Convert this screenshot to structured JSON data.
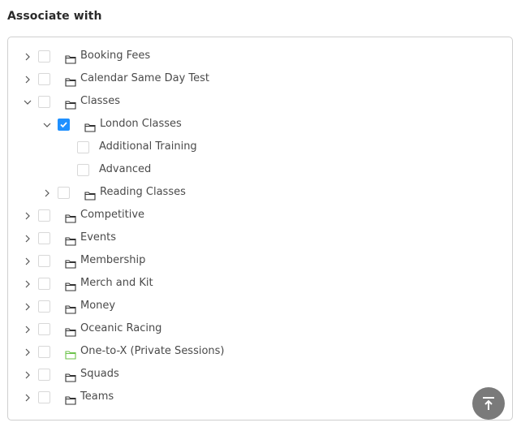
{
  "header": {
    "title": "Associate with"
  },
  "colors": {
    "checked": "#1e90ff",
    "highlight_folder": "#6cc24a",
    "folder": "#333333"
  },
  "tree": [
    {
      "label": "Booking Fees",
      "depth": 0,
      "expander": "collapsed",
      "folder": true,
      "checked": false
    },
    {
      "label": "Calendar Same Day Test",
      "depth": 0,
      "expander": "collapsed",
      "folder": true,
      "checked": false
    },
    {
      "label": "Classes",
      "depth": 0,
      "expander": "expanded",
      "folder": true,
      "checked": false
    },
    {
      "label": "London Classes",
      "depth": 1,
      "expander": "expanded",
      "folder": true,
      "checked": true
    },
    {
      "label": "Additional Training",
      "depth": 2,
      "expander": "none",
      "folder": false,
      "checked": false
    },
    {
      "label": "Advanced",
      "depth": 2,
      "expander": "none",
      "folder": false,
      "checked": false
    },
    {
      "label": "Reading Classes",
      "depth": 1,
      "expander": "collapsed",
      "folder": true,
      "checked": false
    },
    {
      "label": "Competitive",
      "depth": 0,
      "expander": "collapsed",
      "folder": true,
      "checked": false
    },
    {
      "label": "Events",
      "depth": 0,
      "expander": "collapsed",
      "folder": true,
      "checked": false
    },
    {
      "label": "Membership",
      "depth": 0,
      "expander": "collapsed",
      "folder": true,
      "checked": false
    },
    {
      "label": "Merch and Kit",
      "depth": 0,
      "expander": "collapsed",
      "folder": true,
      "checked": false
    },
    {
      "label": "Money",
      "depth": 0,
      "expander": "collapsed",
      "folder": true,
      "checked": false
    },
    {
      "label": "Oceanic Racing",
      "depth": 0,
      "expander": "collapsed",
      "folder": true,
      "checked": false
    },
    {
      "label": "One-to-X (Private Sessions)",
      "depth": 0,
      "expander": "collapsed",
      "folder": true,
      "checked": false,
      "folder_highlight": true
    },
    {
      "label": "Squads",
      "depth": 0,
      "expander": "collapsed",
      "folder": true,
      "checked": false
    },
    {
      "label": "Teams",
      "depth": 0,
      "expander": "collapsed",
      "folder": true,
      "checked": false
    }
  ],
  "scroll_top_button": {
    "icon": "arrow-up-to-line-icon"
  }
}
